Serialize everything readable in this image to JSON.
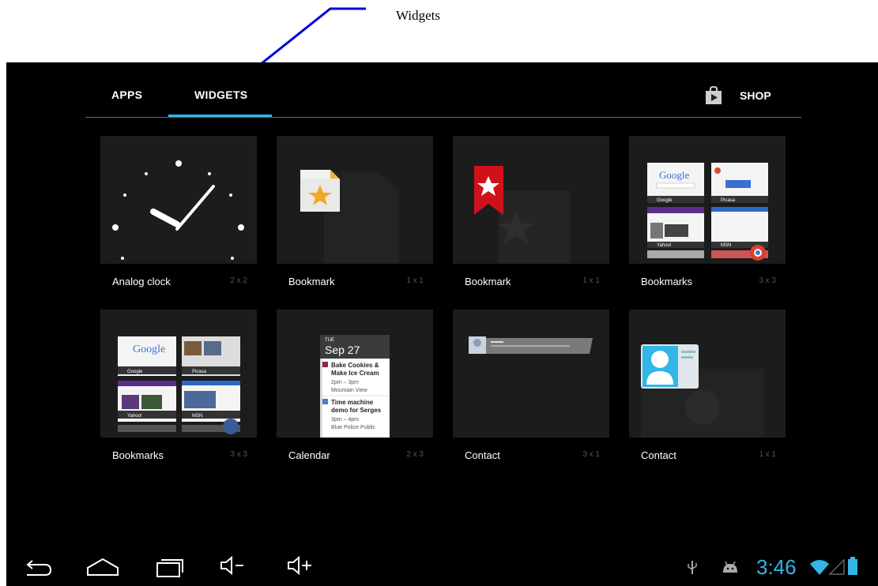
{
  "annotation": {
    "label": "Widgets"
  },
  "tabs": [
    {
      "label": "APPS",
      "selected": false
    },
    {
      "label": "WIDGETS",
      "selected": true
    }
  ],
  "shop": {
    "label": "SHOP",
    "icon": "play-store-bag-icon"
  },
  "widgets": [
    {
      "name": "Analog clock",
      "size": "2 x 2",
      "preview": "analog-clock-preview"
    },
    {
      "name": "Bookmark",
      "size": "1 x 1",
      "preview": "bookmark-file-preview"
    },
    {
      "name": "Bookmark",
      "size": "1 x 1",
      "preview": "bookmark-ribbon-preview"
    },
    {
      "name": "Bookmarks",
      "size": "3 x 3",
      "preview": "bookmarks-grid-preview"
    },
    {
      "name": "Bookmarks",
      "size": "3 x 3",
      "preview": "bookmarks-grid-preview"
    },
    {
      "name": "Calendar",
      "size": "2 x 3",
      "preview": "calendar-preview"
    },
    {
      "name": "Contact",
      "size": "3 x 1",
      "preview": "contact-wide-preview"
    },
    {
      "name": "Contact",
      "size": "1 x 1",
      "preview": "contact-card-preview"
    }
  ],
  "bookmark_previews": {
    "google": "Google",
    "picasa": "Picasa",
    "yahoo": "Yahoo!",
    "msn": "MSN"
  },
  "calendar_preview": {
    "weekday": "TUE",
    "date": "Sep 27",
    "events": [
      {
        "title_line1": "Bake Cookies &",
        "title_line2": "Make Ice Cream",
        "time": "2pm – 3pm",
        "place": "Mountain View"
      },
      {
        "title_line1": "Time machine",
        "title_line2": "demo for Serges",
        "time": "3pm – 4pm",
        "place": "Blue Police Public"
      }
    ]
  },
  "navbar": {
    "buttons": [
      "back-icon",
      "home-icon",
      "recent-apps-icon",
      "volume-down-icon",
      "volume-up-icon"
    ]
  },
  "status": {
    "time": "3:46",
    "icons": [
      "usb-icon",
      "android-debug-icon",
      "wifi-icon",
      "signal-icon",
      "battery-icon"
    ],
    "accent": "#33b5e5"
  },
  "colors": {
    "background": "#000000",
    "tile": "#1c1c1c",
    "accent": "#33b5e5"
  }
}
